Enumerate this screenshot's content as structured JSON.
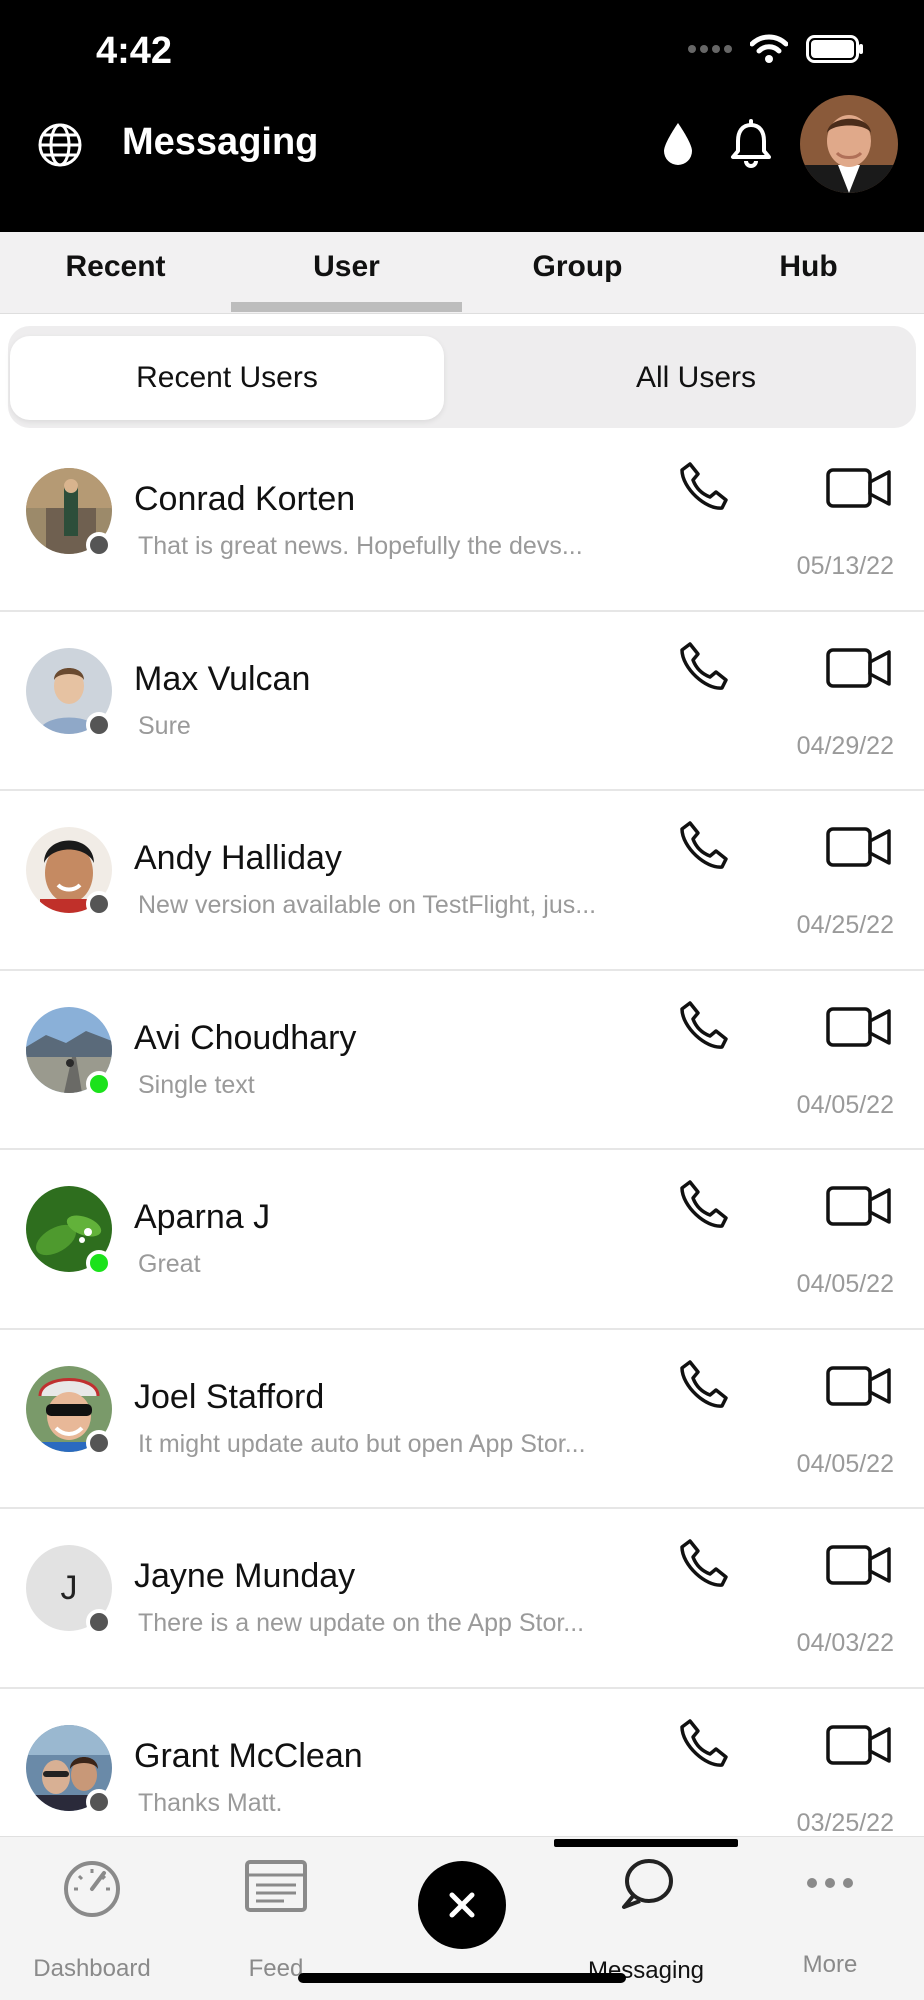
{
  "status_bar": {
    "time": "4:42"
  },
  "header": {
    "title": "Messaging"
  },
  "tabs": [
    {
      "label": "Recent"
    },
    {
      "label": "User"
    },
    {
      "label": "Group"
    },
    {
      "label": "Hub"
    }
  ],
  "active_tab": "User",
  "segment": {
    "recent_users": "Recent Users",
    "all_users": "All Users",
    "active": "Recent Users"
  },
  "conversations": [
    {
      "name": "Conrad Korten",
      "preview": "That is great news.  Hopefully the devs...",
      "date": "05/13/22",
      "online": false,
      "avatar_initial": ""
    },
    {
      "name": "Max Vulcan",
      "preview": "Sure",
      "date": "04/29/22",
      "online": false,
      "avatar_initial": ""
    },
    {
      "name": "Andy Halliday",
      "preview": "New version available on TestFlight, jus...",
      "date": "04/25/22",
      "online": false,
      "avatar_initial": ""
    },
    {
      "name": "Avi Choudhary",
      "preview": "Single text",
      "date": "04/05/22",
      "online": true,
      "avatar_initial": ""
    },
    {
      "name": "Aparna J",
      "preview": "Great",
      "date": "04/05/22",
      "online": true,
      "avatar_initial": ""
    },
    {
      "name": "Joel Stafford",
      "preview": "It might update auto but open App Stor...",
      "date": "04/05/22",
      "online": false,
      "avatar_initial": ""
    },
    {
      "name": "Jayne Munday",
      "preview": "There is a new update on the App Stor...",
      "date": "04/03/22",
      "online": false,
      "avatar_initial": "J"
    },
    {
      "name": "Grant McClean",
      "preview": "Thanks Matt.",
      "date": "03/25/22",
      "online": false,
      "avatar_initial": ""
    }
  ],
  "bottom_nav": [
    {
      "label": "Dashboard",
      "icon": "gauge-icon"
    },
    {
      "label": "Feed",
      "icon": "feed-icon"
    },
    {
      "label": "",
      "icon": "close-icon"
    },
    {
      "label": "Messaging",
      "icon": "chat-bubble-icon"
    },
    {
      "label": "More",
      "icon": "more-dots-icon"
    }
  ],
  "colors": {
    "online": "#1be21b",
    "offline": "#555555",
    "header_bg": "#000000"
  }
}
